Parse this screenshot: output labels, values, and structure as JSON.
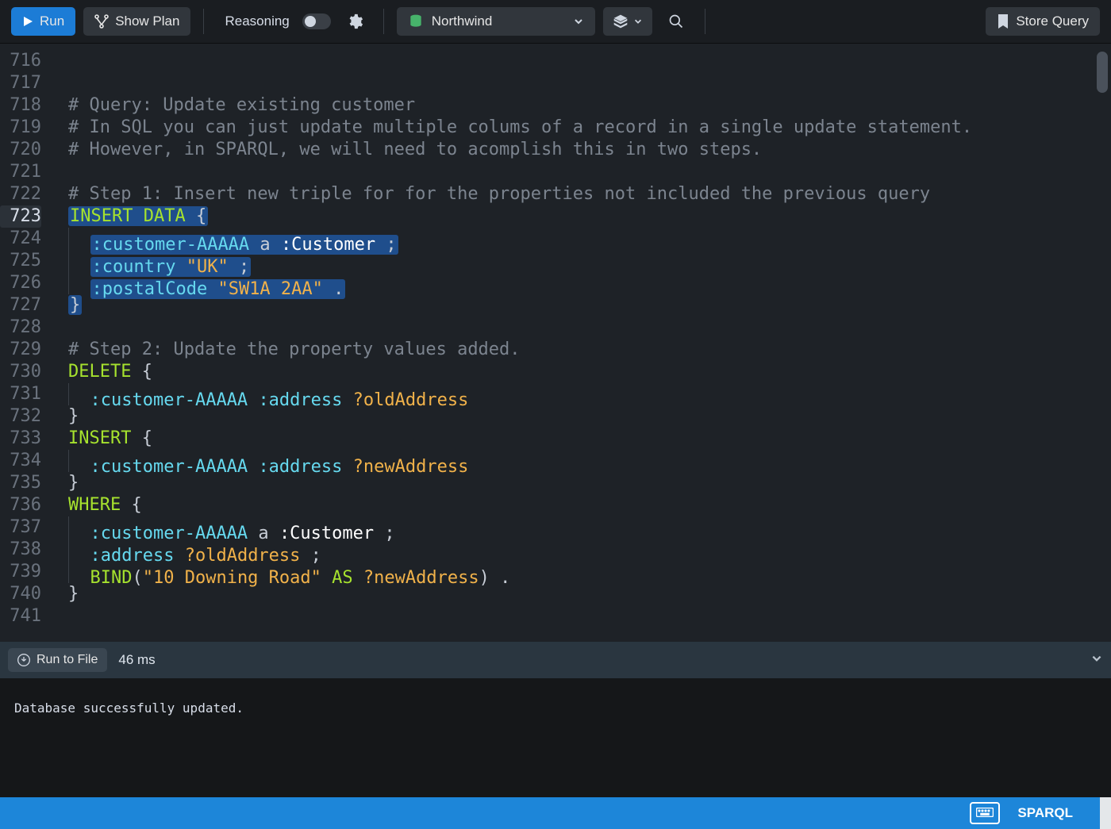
{
  "toolbar": {
    "run": "Run",
    "show_plan": "Show Plan",
    "reasoning_label": "Reasoning",
    "reasoning_enabled": false,
    "database": "Northwind",
    "store_query": "Store Query"
  },
  "editor": {
    "first_line_number": 716,
    "active_line": 723,
    "selection_lines": [
      723,
      724,
      725,
      726,
      727
    ],
    "lines": [
      {
        "n": 716,
        "tokens": []
      },
      {
        "n": 717,
        "tokens": []
      },
      {
        "n": 718,
        "tokens": [
          {
            "t": "# Query: Update existing customer",
            "c": "comment"
          }
        ]
      },
      {
        "n": 719,
        "tokens": [
          {
            "t": "# In SQL you can just update multiple colums of a record in a single update statement.",
            "c": "comment"
          }
        ]
      },
      {
        "n": 720,
        "tokens": [
          {
            "t": "# However, in SPARQL, we will need to acomplish this in two steps.",
            "c": "comment"
          }
        ]
      },
      {
        "n": 721,
        "tokens": []
      },
      {
        "n": 722,
        "tokens": [
          {
            "t": "# Step 1: Insert new triple for for the properties not included the previous query",
            "c": "comment"
          }
        ]
      },
      {
        "n": 723,
        "sel": true,
        "tokens": [
          {
            "t": "INSERT DATA",
            "c": "kw"
          },
          {
            "t": " {",
            "c": "punct"
          }
        ]
      },
      {
        "n": 724,
        "sel": true,
        "indent": 1,
        "tokens": [
          {
            "t": ":customer-AAAAA",
            "c": "prop"
          },
          {
            "t": " a ",
            "c": "var"
          },
          {
            "t": ":Customer",
            "c": "cls"
          },
          {
            "t": " ;",
            "c": "punct"
          }
        ]
      },
      {
        "n": 725,
        "sel": true,
        "indent": 1,
        "tokens": [
          {
            "t": ":country",
            "c": "prop"
          },
          {
            "t": " ",
            "c": "var"
          },
          {
            "t": "\"UK\"",
            "c": "str"
          },
          {
            "t": " ;",
            "c": "punct"
          }
        ]
      },
      {
        "n": 726,
        "sel": true,
        "indent": 1,
        "tokens": [
          {
            "t": ":postalCode",
            "c": "prop"
          },
          {
            "t": " ",
            "c": "var"
          },
          {
            "t": "\"SW1A 2AA\"",
            "c": "str"
          },
          {
            "t": " .",
            "c": "punct"
          }
        ]
      },
      {
        "n": 727,
        "sel": true,
        "tokens": [
          {
            "t": "}",
            "c": "punct"
          }
        ]
      },
      {
        "n": 728,
        "tokens": []
      },
      {
        "n": 729,
        "tokens": [
          {
            "t": "# Step 2: Update the property values added.",
            "c": "comment"
          }
        ]
      },
      {
        "n": 730,
        "tokens": [
          {
            "t": "DELETE",
            "c": "kw"
          },
          {
            "t": " {",
            "c": "punct"
          }
        ]
      },
      {
        "n": 731,
        "indent": 1,
        "tokens": [
          {
            "t": ":customer-AAAAA",
            "c": "prop"
          },
          {
            "t": " ",
            "c": "var"
          },
          {
            "t": ":address",
            "c": "prop"
          },
          {
            "t": " ",
            "c": "var"
          },
          {
            "t": "?oldAddress",
            "c": "str"
          }
        ]
      },
      {
        "n": 732,
        "tokens": [
          {
            "t": "}",
            "c": "punct"
          }
        ]
      },
      {
        "n": 733,
        "tokens": [
          {
            "t": "INSERT",
            "c": "kw"
          },
          {
            "t": " {",
            "c": "punct"
          }
        ]
      },
      {
        "n": 734,
        "indent": 1,
        "tokens": [
          {
            "t": ":customer-AAAAA",
            "c": "prop"
          },
          {
            "t": " ",
            "c": "var"
          },
          {
            "t": ":address",
            "c": "prop"
          },
          {
            "t": " ",
            "c": "var"
          },
          {
            "t": "?newAddress",
            "c": "str"
          }
        ]
      },
      {
        "n": 735,
        "tokens": [
          {
            "t": "}",
            "c": "punct"
          }
        ]
      },
      {
        "n": 736,
        "tokens": [
          {
            "t": "WHERE",
            "c": "kw"
          },
          {
            "t": " {",
            "c": "punct"
          }
        ]
      },
      {
        "n": 737,
        "indent": 1,
        "tokens": [
          {
            "t": ":customer-AAAAA",
            "c": "prop"
          },
          {
            "t": " a ",
            "c": "var"
          },
          {
            "t": ":Customer",
            "c": "cls"
          },
          {
            "t": " ;",
            "c": "punct"
          }
        ]
      },
      {
        "n": 738,
        "indent": 1,
        "tokens": [
          {
            "t": ":address",
            "c": "prop"
          },
          {
            "t": " ",
            "c": "var"
          },
          {
            "t": "?oldAddress",
            "c": "str"
          },
          {
            "t": " ;",
            "c": "punct"
          }
        ]
      },
      {
        "n": 739,
        "indent": 1,
        "tokens": [
          {
            "t": "BIND",
            "c": "kw"
          },
          {
            "t": "(",
            "c": "punct"
          },
          {
            "t": "\"10 Downing Road\"",
            "c": "str"
          },
          {
            "t": " ",
            "c": "var"
          },
          {
            "t": "AS",
            "c": "kw"
          },
          {
            "t": " ",
            "c": "var"
          },
          {
            "t": "?newAddress",
            "c": "str"
          },
          {
            "t": ") .",
            "c": "punct"
          }
        ]
      },
      {
        "n": 740,
        "tokens": [
          {
            "t": "}",
            "c": "punct"
          }
        ]
      },
      {
        "n": 741,
        "tokens": []
      }
    ]
  },
  "results": {
    "run_to_file": "Run to File",
    "timing": "46 ms",
    "output": "Database successfully updated."
  },
  "footer": {
    "language": "SPARQL"
  }
}
